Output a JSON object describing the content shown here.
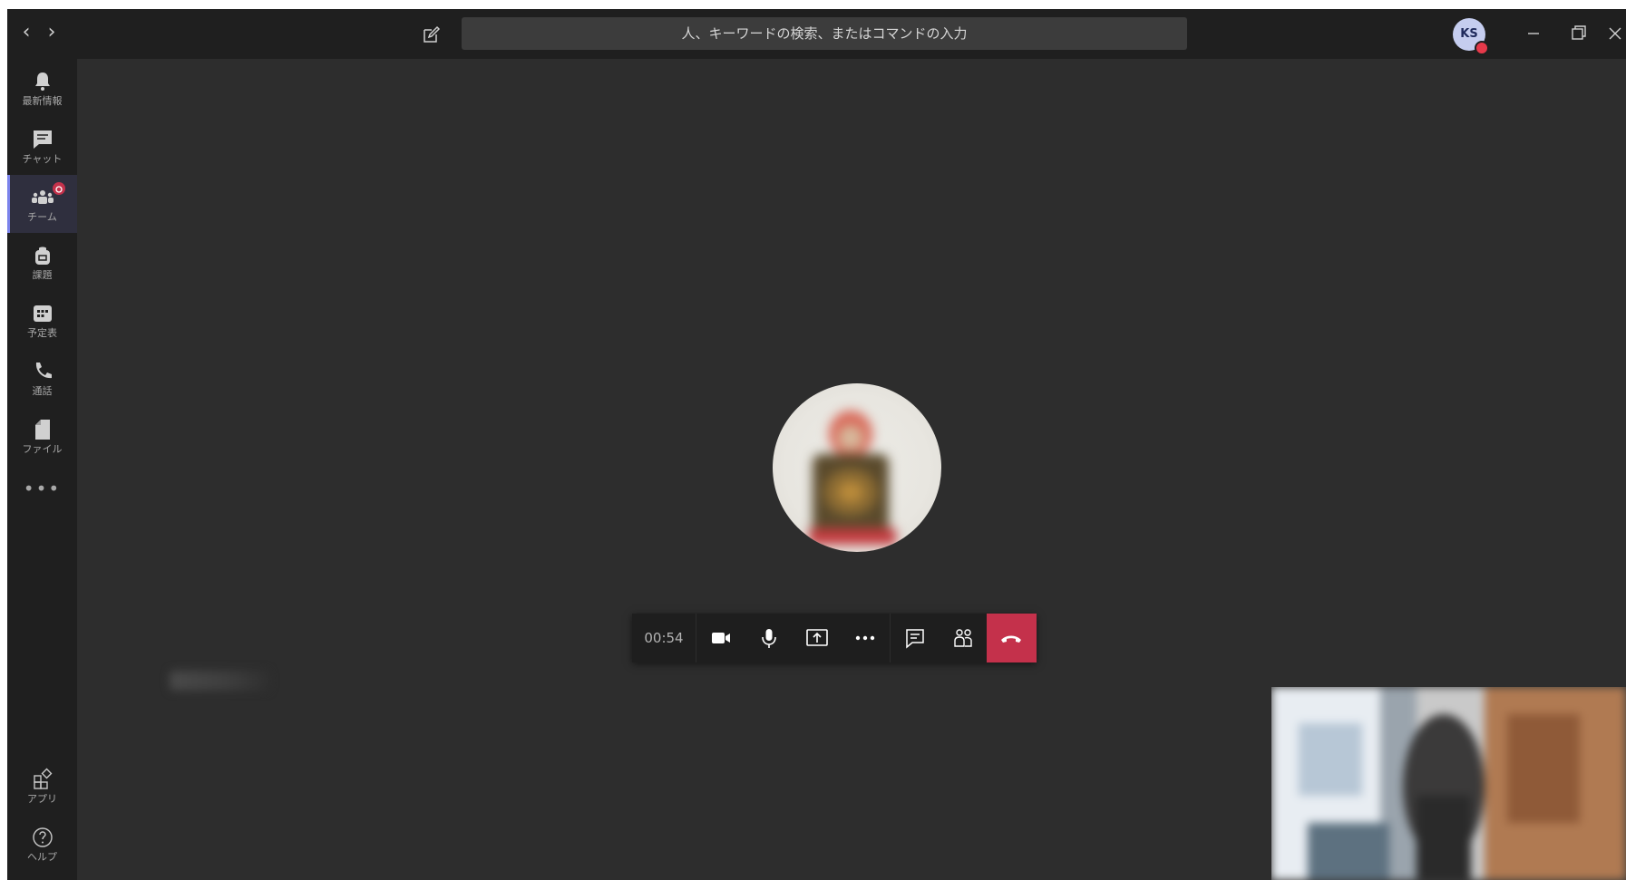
{
  "titlebar": {
    "search_placeholder": "人、キーワードの検索、またはコマンドの入力",
    "avatar_initials": "KS",
    "avatar_status_color": "#e6394a",
    "icons": [
      "back-arrow-icon",
      "forward-arrow-icon",
      "compose-icon",
      "minimize-icon",
      "restore-icon",
      "close-icon"
    ]
  },
  "rail": {
    "items": [
      {
        "label": "最新情報",
        "icon": "bell-icon",
        "active": false
      },
      {
        "label": "チャット",
        "icon": "chat-icon",
        "active": false
      },
      {
        "label": "チーム",
        "icon": "teams-icon",
        "active": true,
        "badge": true
      },
      {
        "label": "課題",
        "icon": "backpack-icon",
        "active": false
      },
      {
        "label": "予定表",
        "icon": "calendar-icon",
        "active": false
      },
      {
        "label": "通話",
        "icon": "phone-icon",
        "active": false
      },
      {
        "label": "ファイル",
        "icon": "file-icon",
        "active": false
      }
    ],
    "more": "•••",
    "bottom_items": [
      {
        "label": "アプリ",
        "icon": "apps-icon"
      },
      {
        "label": "ヘルプ",
        "icon": "help-icon"
      }
    ],
    "accent_color": "#7b83eb",
    "badge_color": "#c4314b"
  },
  "call": {
    "timer": "00:54",
    "controls": [
      "camera-icon",
      "microphone-icon",
      "share-screen-icon",
      "more-options-icon",
      "chat-icon",
      "participants-icon",
      "hangup-icon"
    ],
    "hangup_color": "#c4314b"
  }
}
